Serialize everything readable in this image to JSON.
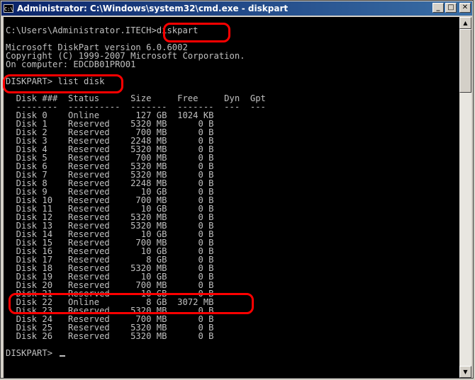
{
  "window": {
    "title": "Administrator: C:\\Windows\\system32\\cmd.exe - diskpart",
    "icon_label": "C:\\",
    "buttons": {
      "minimize": "_",
      "maximize": "□",
      "close": "✕"
    }
  },
  "console": {
    "lines": [
      "C:\\Users\\Administrator.ITECH>diskpart",
      "",
      "Microsoft DiskPart version 6.0.6002",
      "Copyright (C) 1999-2007 Microsoft Corporation.",
      "On computer: EDCDB01PRO01",
      "",
      "DISKPART> list disk",
      "",
      "  Disk ###  Status      Size     Free     Dyn  Gpt",
      "  --------  ----------  -------  -------  ---  ---",
      "  Disk 0    Online       127 GB  1024 KB",
      "  Disk 1    Reserved    5320 MB      0 B",
      "  Disk 2    Reserved     700 MB      0 B",
      "  Disk 3    Reserved    2248 MB      0 B",
      "  Disk 4    Reserved    5320 MB      0 B",
      "  Disk 5    Reserved     700 MB      0 B",
      "  Disk 6    Reserved    5320 MB      0 B",
      "  Disk 7    Reserved    5320 MB      0 B",
      "  Disk 8    Reserved    2248 MB      0 B",
      "  Disk 9    Reserved      10 GB      0 B",
      "  Disk 10   Reserved     700 MB      0 B",
      "  Disk 11   Reserved      10 GB      0 B",
      "  Disk 12   Reserved    5320 MB      0 B",
      "  Disk 13   Reserved    5320 MB      0 B",
      "  Disk 14   Reserved      10 GB      0 B",
      "  Disk 15   Reserved     700 MB      0 B",
      "  Disk 16   Reserved      10 GB      0 B",
      "  Disk 17   Reserved       8 GB      0 B",
      "  Disk 18   Reserved    5320 MB      0 B",
      "  Disk 19   Reserved      10 GB      0 B",
      "  Disk 20   Reserved     700 MB      0 B",
      "  Disk 21   Reserved      10 GB      0 B",
      "  Disk 22   Online         8 GB  3072 MB",
      "  Disk 23   Reserved    5320 MB      0 B",
      "  Disk 24   Reserved     700 MB      0 B",
      "  Disk 25   Reserved    5320 MB      0 B",
      "  Disk 26   Reserved    5320 MB      0 B",
      "",
      "DISKPART> "
    ]
  },
  "annotations": {
    "highlight_color": "#ff0000"
  }
}
